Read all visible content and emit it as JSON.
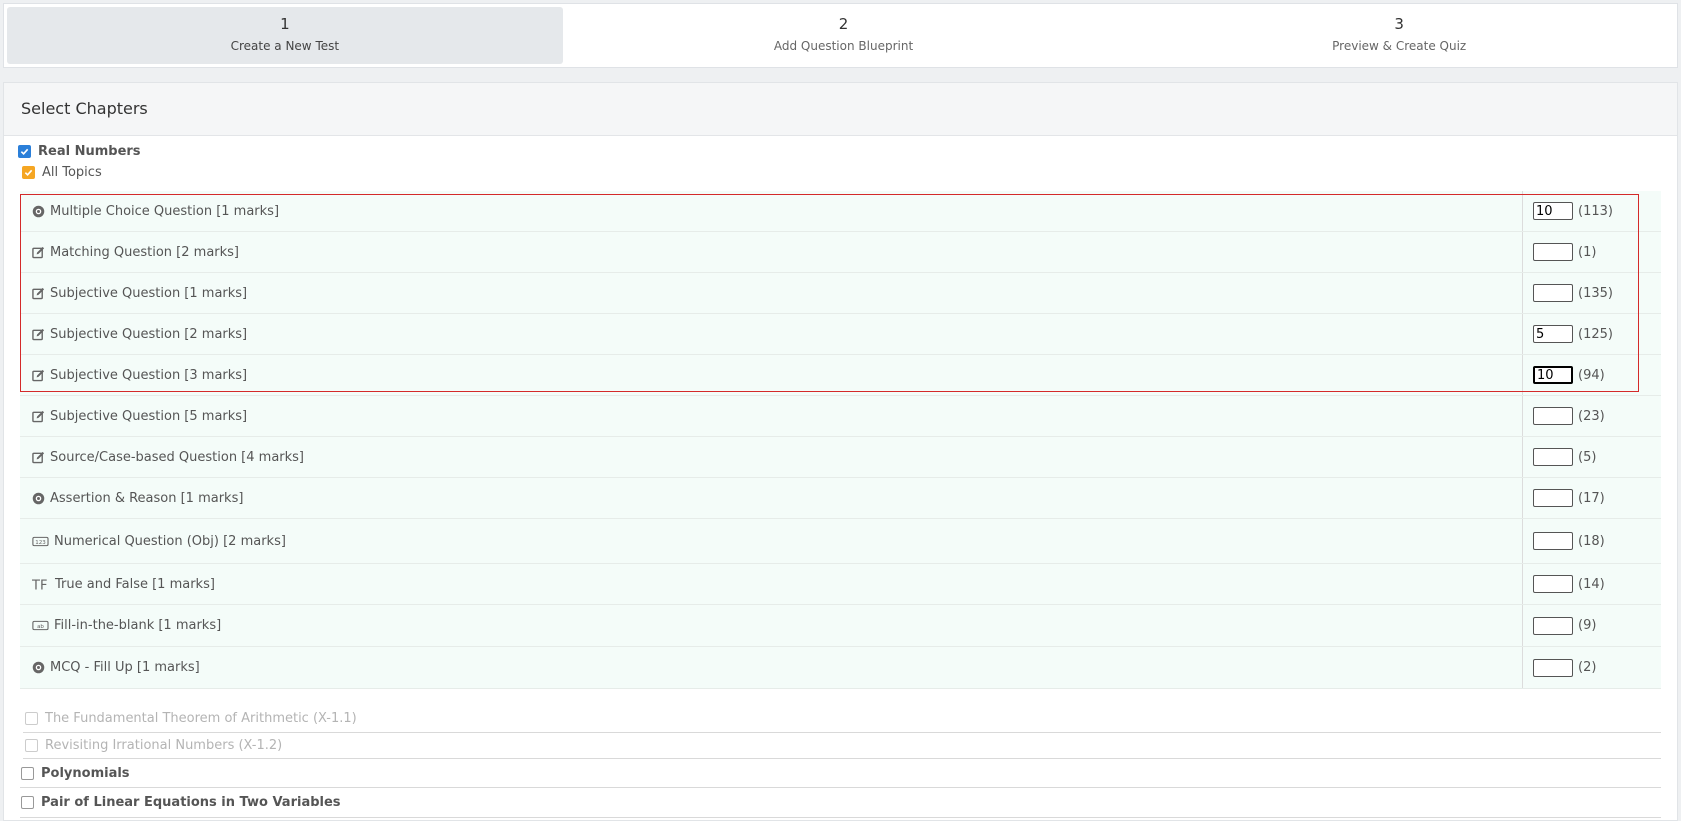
{
  "stepper": [
    {
      "number": "1",
      "label": "Create a New Test",
      "active": true
    },
    {
      "number": "2",
      "label": "Add Question Blueprint",
      "active": false
    },
    {
      "number": "3",
      "label": "Preview & Create Quiz",
      "active": false
    }
  ],
  "card": {
    "title": "Select Chapters"
  },
  "chapter": {
    "name": "Real Numbers",
    "checked": true
  },
  "all_topics": {
    "label": "All Topics",
    "checked": true
  },
  "questions": [
    {
      "icon": "radio-icon",
      "label": "Multiple Choice Question [1 marks]",
      "value": "10",
      "count": "(113)"
    },
    {
      "icon": "edit-icon",
      "label": "Matching Question [2 marks]",
      "value": "",
      "count": "(1)"
    },
    {
      "icon": "edit-icon",
      "label": "Subjective Question [1 marks]",
      "value": "",
      "count": "(135)"
    },
    {
      "icon": "edit-icon",
      "label": "Subjective Question [2 marks]",
      "value": "5",
      "count": "(125)"
    },
    {
      "icon": "edit-icon",
      "label": "Subjective Question [3 marks]",
      "value": "10",
      "count": "(94)"
    },
    {
      "icon": "edit-icon",
      "label": "Subjective Question [5 marks]",
      "value": "",
      "count": "(23)"
    },
    {
      "icon": "edit-icon",
      "label": "Source/Case-based Question [4 marks]",
      "value": "",
      "count": "(5)"
    },
    {
      "icon": "radio-icon",
      "label": "Assertion & Reason [1 marks]",
      "value": "",
      "count": "(17)"
    },
    {
      "icon": "numeric-icon",
      "label": "Numerical Question (Obj) [2 marks]",
      "value": "",
      "count": "(18)"
    },
    {
      "icon": "true-false-icon",
      "label": "True and False [1 marks]",
      "value": "",
      "count": "(14)"
    },
    {
      "icon": "fill-blank-icon",
      "label": "Fill-in-the-blank [1 marks]",
      "value": "",
      "count": "(9)"
    },
    {
      "icon": "radio-icon",
      "label": "MCQ - Fill Up [1 marks]",
      "value": "",
      "count": "(2)"
    }
  ],
  "subtopics": [
    {
      "label": "The Fundamental Theorem of Arithmetic (X-1.1)"
    },
    {
      "label": "Revisiting Irrational Numbers (X-1.2)"
    }
  ],
  "other_chapters": [
    {
      "label": "Polynomials"
    },
    {
      "label": "Pair of Linear Equations in Two Variables"
    }
  ],
  "icons": {
    "check": "check-icon"
  },
  "colors": {
    "highlight_border": "#d42a2a",
    "checkbox_blue": "#2b7fd9",
    "checkbox_orange": "#f5a623",
    "row_bg": "#f4fcf9"
  }
}
